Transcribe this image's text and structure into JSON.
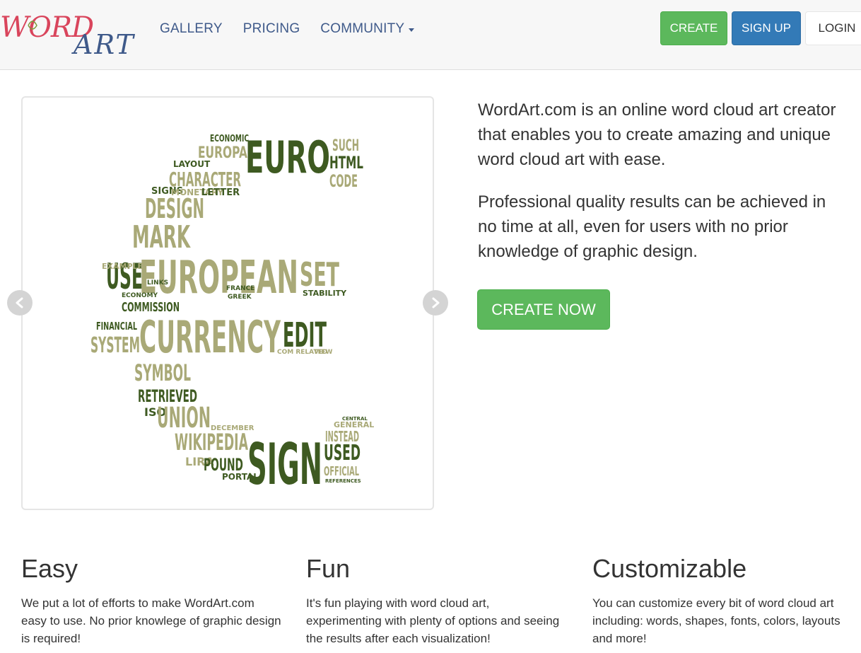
{
  "colors": {
    "green": "#5cb85c",
    "blue": "#337ab7",
    "nav_link": "#3f5a8a",
    "cloud_dark": "#3e5a21",
    "cloud_light": "#a9a977"
  },
  "nav": {
    "logo_text": "WordArt",
    "links": [
      {
        "label": "GALLERY"
      },
      {
        "label": "PRICING"
      },
      {
        "label": "COMMUNITY",
        "has_caret": true
      }
    ],
    "buttons": {
      "create": "CREATE",
      "signup": "SIGN UP",
      "login": "LOGIN"
    }
  },
  "hero": {
    "paragraphs": [
      "WordArt.com is an online word cloud art creator that enables you to create amazing and unique word cloud art with ease.",
      "Professional quality results can be achieved in no time at all, even for users with no prior knowledge of graphic design."
    ],
    "cta": "CREATE NOW",
    "carousel": {
      "prev_icon": "chevron-left-icon",
      "next_icon": "chevron-right-icon",
      "words": [
        "EURO",
        "EUROPA",
        "ECONOMIC",
        "SUCH",
        "HTML",
        "CODE",
        "CHARACTER",
        "LAYOUT",
        "SIGNS",
        "MONETARY",
        "LETTER",
        "DESIGN",
        "MARK",
        "USE",
        "EUROPEAN",
        "SET",
        "STABILITY",
        "COMMISSION",
        "FINANCIAL",
        "SYSTEM",
        "CURRENCY",
        "EDIT",
        "SYMBOL",
        "RETRIEVED",
        "ISO",
        "UNION",
        "WIKIPEDIA",
        "SIGN",
        "USED",
        "INSTEAD",
        "GENERAL",
        "LIRA",
        "POUND",
        "OFFICIAL",
        "PORTAL",
        "DECEMBER",
        "EXAMPLE",
        "LINKS",
        "ECONOMY",
        "FRANCE",
        "GREEK",
        "RELATED",
        "VIEW",
        "CENTRAL",
        "REFERENCES"
      ]
    }
  },
  "features": [
    {
      "title": "Easy",
      "text": "We put a lot of efforts to make WordArt.com easy to use. No prior knowlege of graphic design is required!"
    },
    {
      "title": "Fun",
      "text": "It's fun playing with word cloud art, experimenting with plenty of options and seeing the results after each visualization!"
    },
    {
      "title": "Customizable",
      "text": "You can customize every bit of word cloud art including: words, shapes, fonts, colors, layouts and more!"
    }
  ]
}
